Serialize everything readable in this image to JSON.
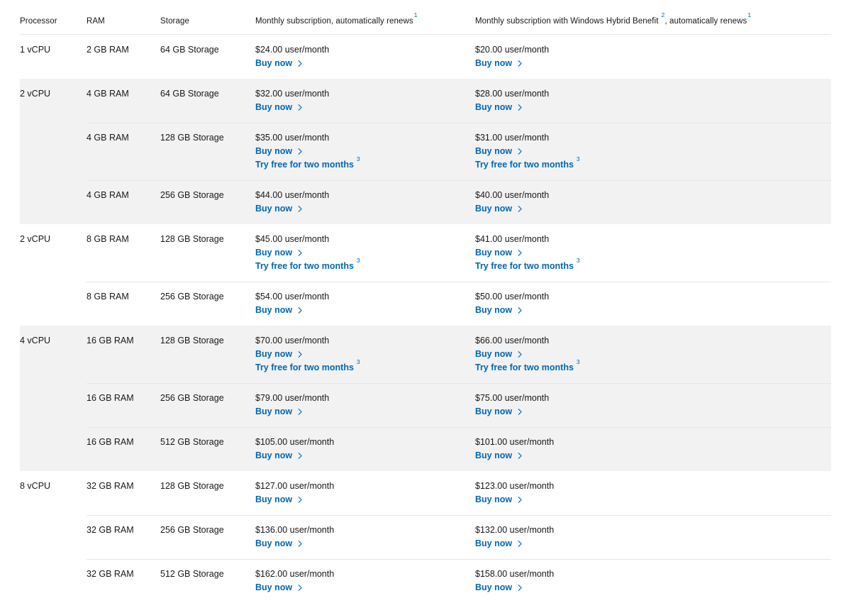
{
  "table": {
    "columns": {
      "processor": "Processor",
      "ram": "RAM",
      "storage": "Storage",
      "price_standard": "Monthly subscription, automatically renews",
      "price_standard_footnote": "1",
      "price_hybrid_prefix": "Monthly subscription with Windows Hybrid Benefit",
      "price_hybrid_footnote_a": "2",
      "price_hybrid_suffix": ", automatically renews",
      "price_hybrid_footnote_b": "1"
    },
    "labels": {
      "buy_now": "Buy now",
      "try_free": "Try free for two months",
      "try_free_footnote": "3",
      "chevron_icon": "chevron-right-icon"
    },
    "colors": {
      "link": "#0067b8",
      "text": "#171717",
      "band": "#f2f2f2",
      "divider": "#e6e6e6"
    },
    "groups": [
      {
        "shaded": false,
        "processor": "1 vCPU",
        "rows": [
          {
            "ram": "2 GB RAM",
            "storage": "64 GB Storage",
            "standard": {
              "price": "$24.00 user/month",
              "buy_now": true,
              "try_free": false
            },
            "hybrid": {
              "price": "$20.00 user/month",
              "buy_now": true,
              "try_free": false
            }
          }
        ]
      },
      {
        "shaded": true,
        "processor": "2 vCPU",
        "rows": [
          {
            "ram": "4 GB RAM",
            "storage": "64 GB Storage",
            "standard": {
              "price": "$32.00 user/month",
              "buy_now": true,
              "try_free": false
            },
            "hybrid": {
              "price": "$28.00 user/month",
              "buy_now": true,
              "try_free": false
            }
          },
          {
            "ram": "4 GB RAM",
            "storage": "128 GB Storage",
            "standard": {
              "price": "$35.00 user/month",
              "buy_now": true,
              "try_free": true
            },
            "hybrid": {
              "price": "$31.00 user/month",
              "buy_now": true,
              "try_free": true
            }
          },
          {
            "ram": "4 GB RAM",
            "storage": "256 GB Storage",
            "standard": {
              "price": "$44.00 user/month",
              "buy_now": true,
              "try_free": false
            },
            "hybrid": {
              "price": "$40.00 user/month",
              "buy_now": true,
              "try_free": false
            }
          }
        ]
      },
      {
        "shaded": false,
        "processor": "2 vCPU",
        "rows": [
          {
            "ram": "8 GB RAM",
            "storage": "128 GB Storage",
            "standard": {
              "price": "$45.00 user/month",
              "buy_now": true,
              "try_free": true
            },
            "hybrid": {
              "price": "$41.00 user/month",
              "buy_now": true,
              "try_free": true
            }
          },
          {
            "ram": "8 GB RAM",
            "storage": "256 GB Storage",
            "standard": {
              "price": "$54.00 user/month",
              "buy_now": true,
              "try_free": false
            },
            "hybrid": {
              "price": "$50.00 user/month",
              "buy_now": true,
              "try_free": false
            }
          }
        ]
      },
      {
        "shaded": true,
        "processor": "4 vCPU",
        "rows": [
          {
            "ram": "16 GB RAM",
            "storage": "128 GB Storage",
            "standard": {
              "price": "$70.00 user/month",
              "buy_now": true,
              "try_free": true
            },
            "hybrid": {
              "price": "$66.00 user/month",
              "buy_now": true,
              "try_free": true
            }
          },
          {
            "ram": "16 GB RAM",
            "storage": "256 GB Storage",
            "standard": {
              "price": "$79.00 user/month",
              "buy_now": true,
              "try_free": false
            },
            "hybrid": {
              "price": "$75.00 user/month",
              "buy_now": true,
              "try_free": false
            }
          },
          {
            "ram": "16 GB RAM",
            "storage": "512 GB Storage",
            "standard": {
              "price": "$105.00 user/month",
              "buy_now": true,
              "try_free": false
            },
            "hybrid": {
              "price": "$101.00 user/month",
              "buy_now": true,
              "try_free": false
            }
          }
        ]
      },
      {
        "shaded": false,
        "processor": "8 vCPU",
        "rows": [
          {
            "ram": "32 GB RAM",
            "storage": "128 GB Storage",
            "standard": {
              "price": "$127.00 user/month",
              "buy_now": true,
              "try_free": false
            },
            "hybrid": {
              "price": "$123.00 user/month",
              "buy_now": true,
              "try_free": false
            }
          },
          {
            "ram": "32 GB RAM",
            "storage": "256 GB Storage",
            "standard": {
              "price": "$136.00 user/month",
              "buy_now": true,
              "try_free": false
            },
            "hybrid": {
              "price": "$132.00 user/month",
              "buy_now": true,
              "try_free": false
            }
          },
          {
            "ram": "32 GB RAM",
            "storage": "512 GB Storage",
            "standard": {
              "price": "$162.00 user/month",
              "buy_now": true,
              "try_free": false
            },
            "hybrid": {
              "price": "$158.00 user/month",
              "buy_now": true,
              "try_free": false
            }
          }
        ]
      }
    ]
  }
}
